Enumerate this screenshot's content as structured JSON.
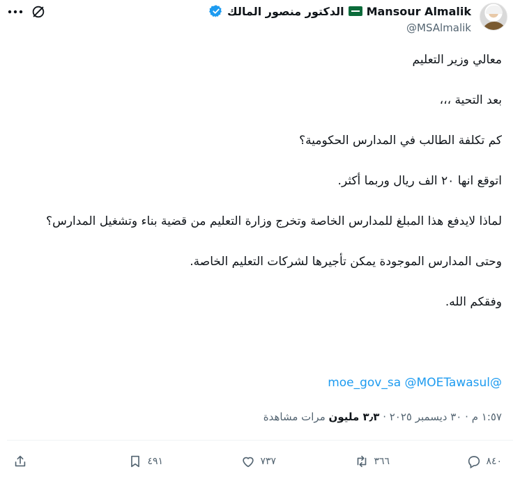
{
  "user": {
    "display_name": "Mansour Almalik",
    "arabic_name": "الدكتور منصور المالك",
    "handle": "@MSAlmalik"
  },
  "tweet": {
    "paragraphs": [
      "معالي وزير التعليم",
      "بعد التحية ،،،",
      "كم تكلفة الطالب في المدارس الحكومية؟",
      "اتوقع انها ٢٠ الف ريال وربما أكثر.",
      "لماذا لايدفع هذا المبلغ للمدارس الخاصة وتخرج وزارة التعليم من قضية بناء وتشغيل المدارس؟",
      "وحتى المدارس الموجودة يمكن تأجيرها لشركات التعليم الخاصة.",
      "وفقكم الله."
    ],
    "mentions": [
      "@moe_gov_sa",
      "@MOETawasul"
    ]
  },
  "meta": {
    "time": "١:٥٧ م",
    "date": "٣٠ ديسمبر ٢٠٢٥",
    "separator": "·",
    "views_count": "٣٫٣ مليون",
    "views_label": "مرات مشاهدة"
  },
  "actions": {
    "replies": "٨٤٠",
    "reposts": "٣٦٦",
    "likes": "٧٣٧",
    "bookmarks": "٤٩١"
  },
  "colors": {
    "link": "#1d9bf0",
    "muted": "#536471",
    "text": "#0f1419"
  }
}
